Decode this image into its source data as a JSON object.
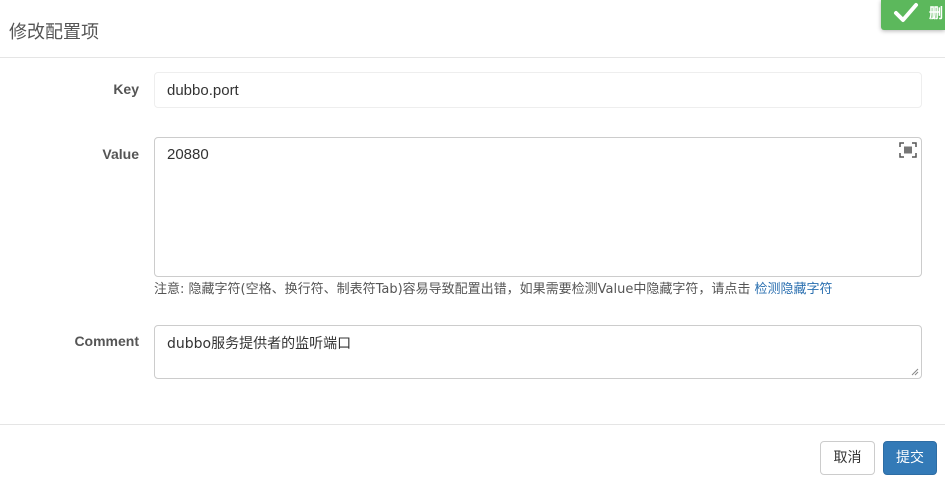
{
  "modal": {
    "title": "修改配置项"
  },
  "form": {
    "key_label": "Key",
    "key_value": "dubbo.port",
    "value_label": "Value",
    "value_value": "20880",
    "hint_text": "注意: 隐藏字符(空格、换行符、制表符Tab)容易导致配置出错，如果需要检测Value中隐藏字符，请点击 ",
    "hint_link": "检测隐藏字符",
    "comment_label": "Comment",
    "comment_value": "dubbo服务提供者的监听端口"
  },
  "footer": {
    "cancel_label": "取消",
    "submit_label": "提交"
  },
  "toast": {
    "text": "删",
    "icon": "check-icon",
    "color": "#5cb85c"
  },
  "colors": {
    "primary": "#337ab7",
    "link": "#2a6fb0"
  }
}
